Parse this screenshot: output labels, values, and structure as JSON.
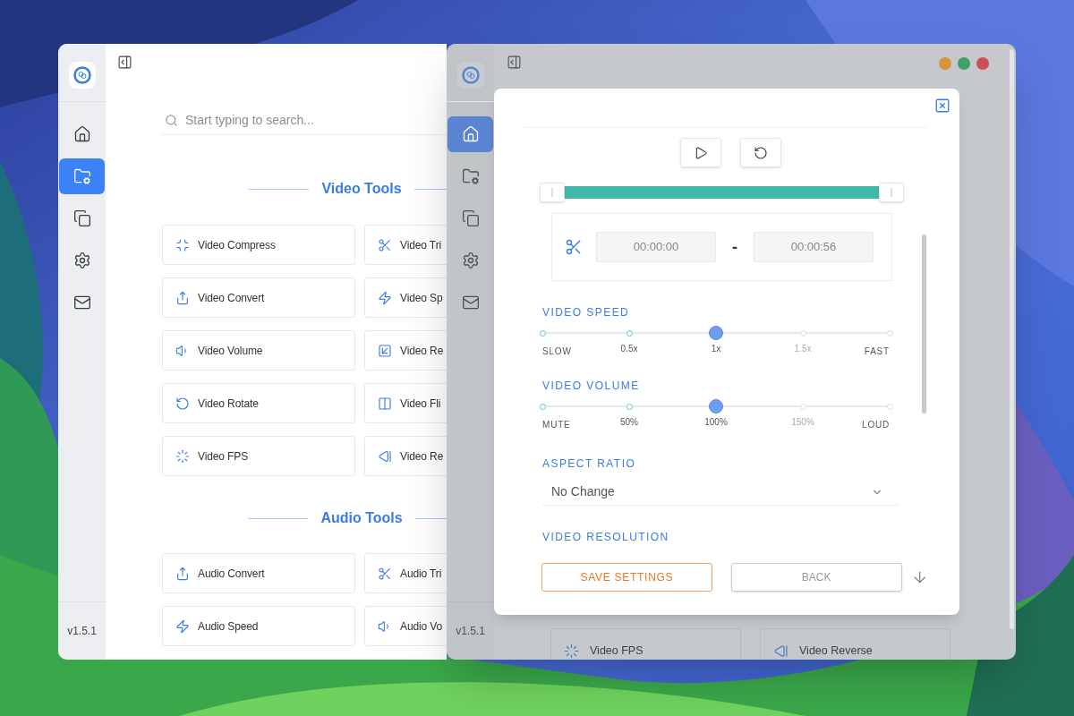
{
  "tools_window": {
    "sidebar": {
      "items": [
        {
          "selected": false
        },
        {
          "selected": true
        },
        {
          "selected": false
        },
        {
          "selected": false
        },
        {
          "selected": false
        }
      ],
      "version": "v1.5.1"
    },
    "search": {
      "placeholder": "Start typing to search..."
    },
    "sections": [
      {
        "title": "Video Tools",
        "tools": [
          "Video Compress",
          "Video Tri",
          "Video Convert",
          "Video Sp",
          "Video Volume",
          "Video Re",
          "Video Rotate",
          "Video Fli",
          "Video FPS",
          "Video Re"
        ]
      },
      {
        "title": "Audio Tools",
        "tools": [
          "Audio Convert",
          "Audio Tri",
          "Audio Speed",
          "Audio Vo"
        ]
      }
    ]
  },
  "editor_window": {
    "sidebar": {
      "items": [
        {
          "selected": true
        },
        {
          "selected": false
        },
        {
          "selected": false
        },
        {
          "selected": false
        },
        {
          "selected": false
        }
      ],
      "version": "v1.5.1"
    },
    "background_tools": [
      "Video FPS",
      "Video Reverse"
    ],
    "dialog": {
      "trim_range": {
        "level": 1
      },
      "trim": {
        "start": "00:00:00",
        "separator": "-",
        "end": "00:00:56"
      },
      "sliders": [
        {
          "title": "VIDEO SPEED",
          "level": 0.5,
          "stops": [
            "SLOW",
            "0.5x",
            "1x",
            "1.5x",
            "FAST"
          ]
        },
        {
          "title": "VIDEO VOLUME",
          "level": 0.5,
          "stops": [
            "MUTE",
            "50%",
            "100%",
            "150%",
            "LOUD"
          ]
        }
      ],
      "aspect_ratio": {
        "title": "ASPECT RATIO",
        "value": "No Change"
      },
      "resolution": {
        "title": "VIDEO RESOLUTION"
      },
      "buttons": {
        "save": "SAVE SETTINGS",
        "back": "BACK"
      }
    }
  }
}
